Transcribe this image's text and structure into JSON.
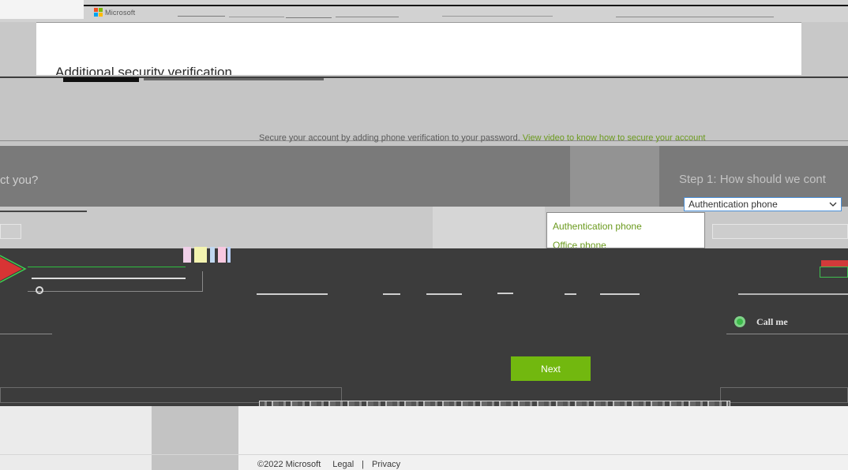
{
  "brand": {
    "logo_text": "Microsoft",
    "logo_colors": [
      "#f25022",
      "#7fba00",
      "#00a4ef",
      "#ffb900"
    ]
  },
  "header": {
    "title": "Additional security verification"
  },
  "intro": {
    "text": "Secure your account by adding phone verification to your password. ",
    "video_link": "View video to know how to secure your account"
  },
  "step1": {
    "left_fragment": "ct you?",
    "title_fragment": "Step 1: How should we cont"
  },
  "contact_method": {
    "selected": "Authentication phone",
    "options": [
      "Authentication phone",
      "Office phone"
    ]
  },
  "call_option": {
    "label": "Call me",
    "selected": true
  },
  "actions": {
    "next": "Next"
  },
  "footer": {
    "copyright": "©2022 Microsoft",
    "legal": "Legal",
    "separator": "|",
    "privacy": "Privacy"
  },
  "colors": {
    "accent_green": "#72b80f",
    "link_green": "#6b9a1e",
    "radio_green": "#3cba4a",
    "focus_blue": "#4a90d9"
  },
  "icons": {
    "logo": "microsoft-logo-icon",
    "select": "chevron-down-icon",
    "call": "radio-selected-icon",
    "text_option": "radio-icon"
  }
}
